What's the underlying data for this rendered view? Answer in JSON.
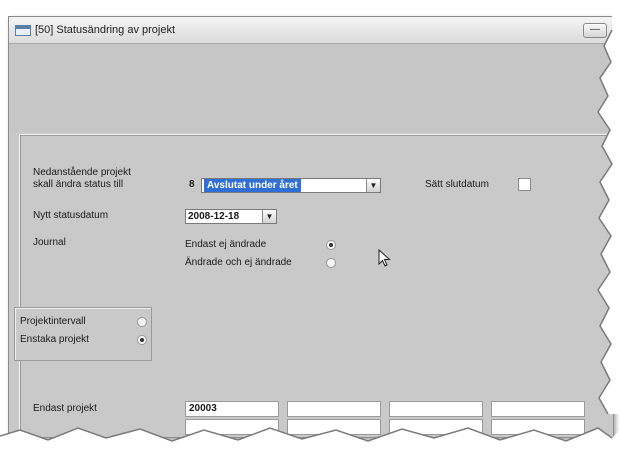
{
  "window": {
    "title": "[50] Statusändring av projekt",
    "restore_glyph": "—"
  },
  "form": {
    "status_label_line1": "Nedanstående projekt",
    "status_label_line2": "skall ändra status till",
    "status_code": "8",
    "status_value": "Avslutat under året",
    "set_end_date_label": "Sätt slutdatum",
    "set_end_date_checked": false,
    "new_date_label": "Nytt statusdatum",
    "new_date_value": "2008-12-18",
    "journal_label": "Journal",
    "journal_options": [
      {
        "label": "Endast ej ändrade",
        "selected": true
      },
      {
        "label": "Ändrade och ej ändrade",
        "selected": false
      }
    ]
  },
  "project_mode": {
    "options": [
      {
        "label": "Projektintervall",
        "selected": false
      },
      {
        "label": "Enstaka projekt",
        "selected": true
      }
    ]
  },
  "projects": {
    "label": "Endast projekt",
    "values": [
      "20003",
      "",
      "",
      "",
      "",
      "",
      "",
      ""
    ]
  },
  "icons": {
    "dropdown": "chevron-down-icon",
    "cursor": "mouse-pointer-icon"
  }
}
